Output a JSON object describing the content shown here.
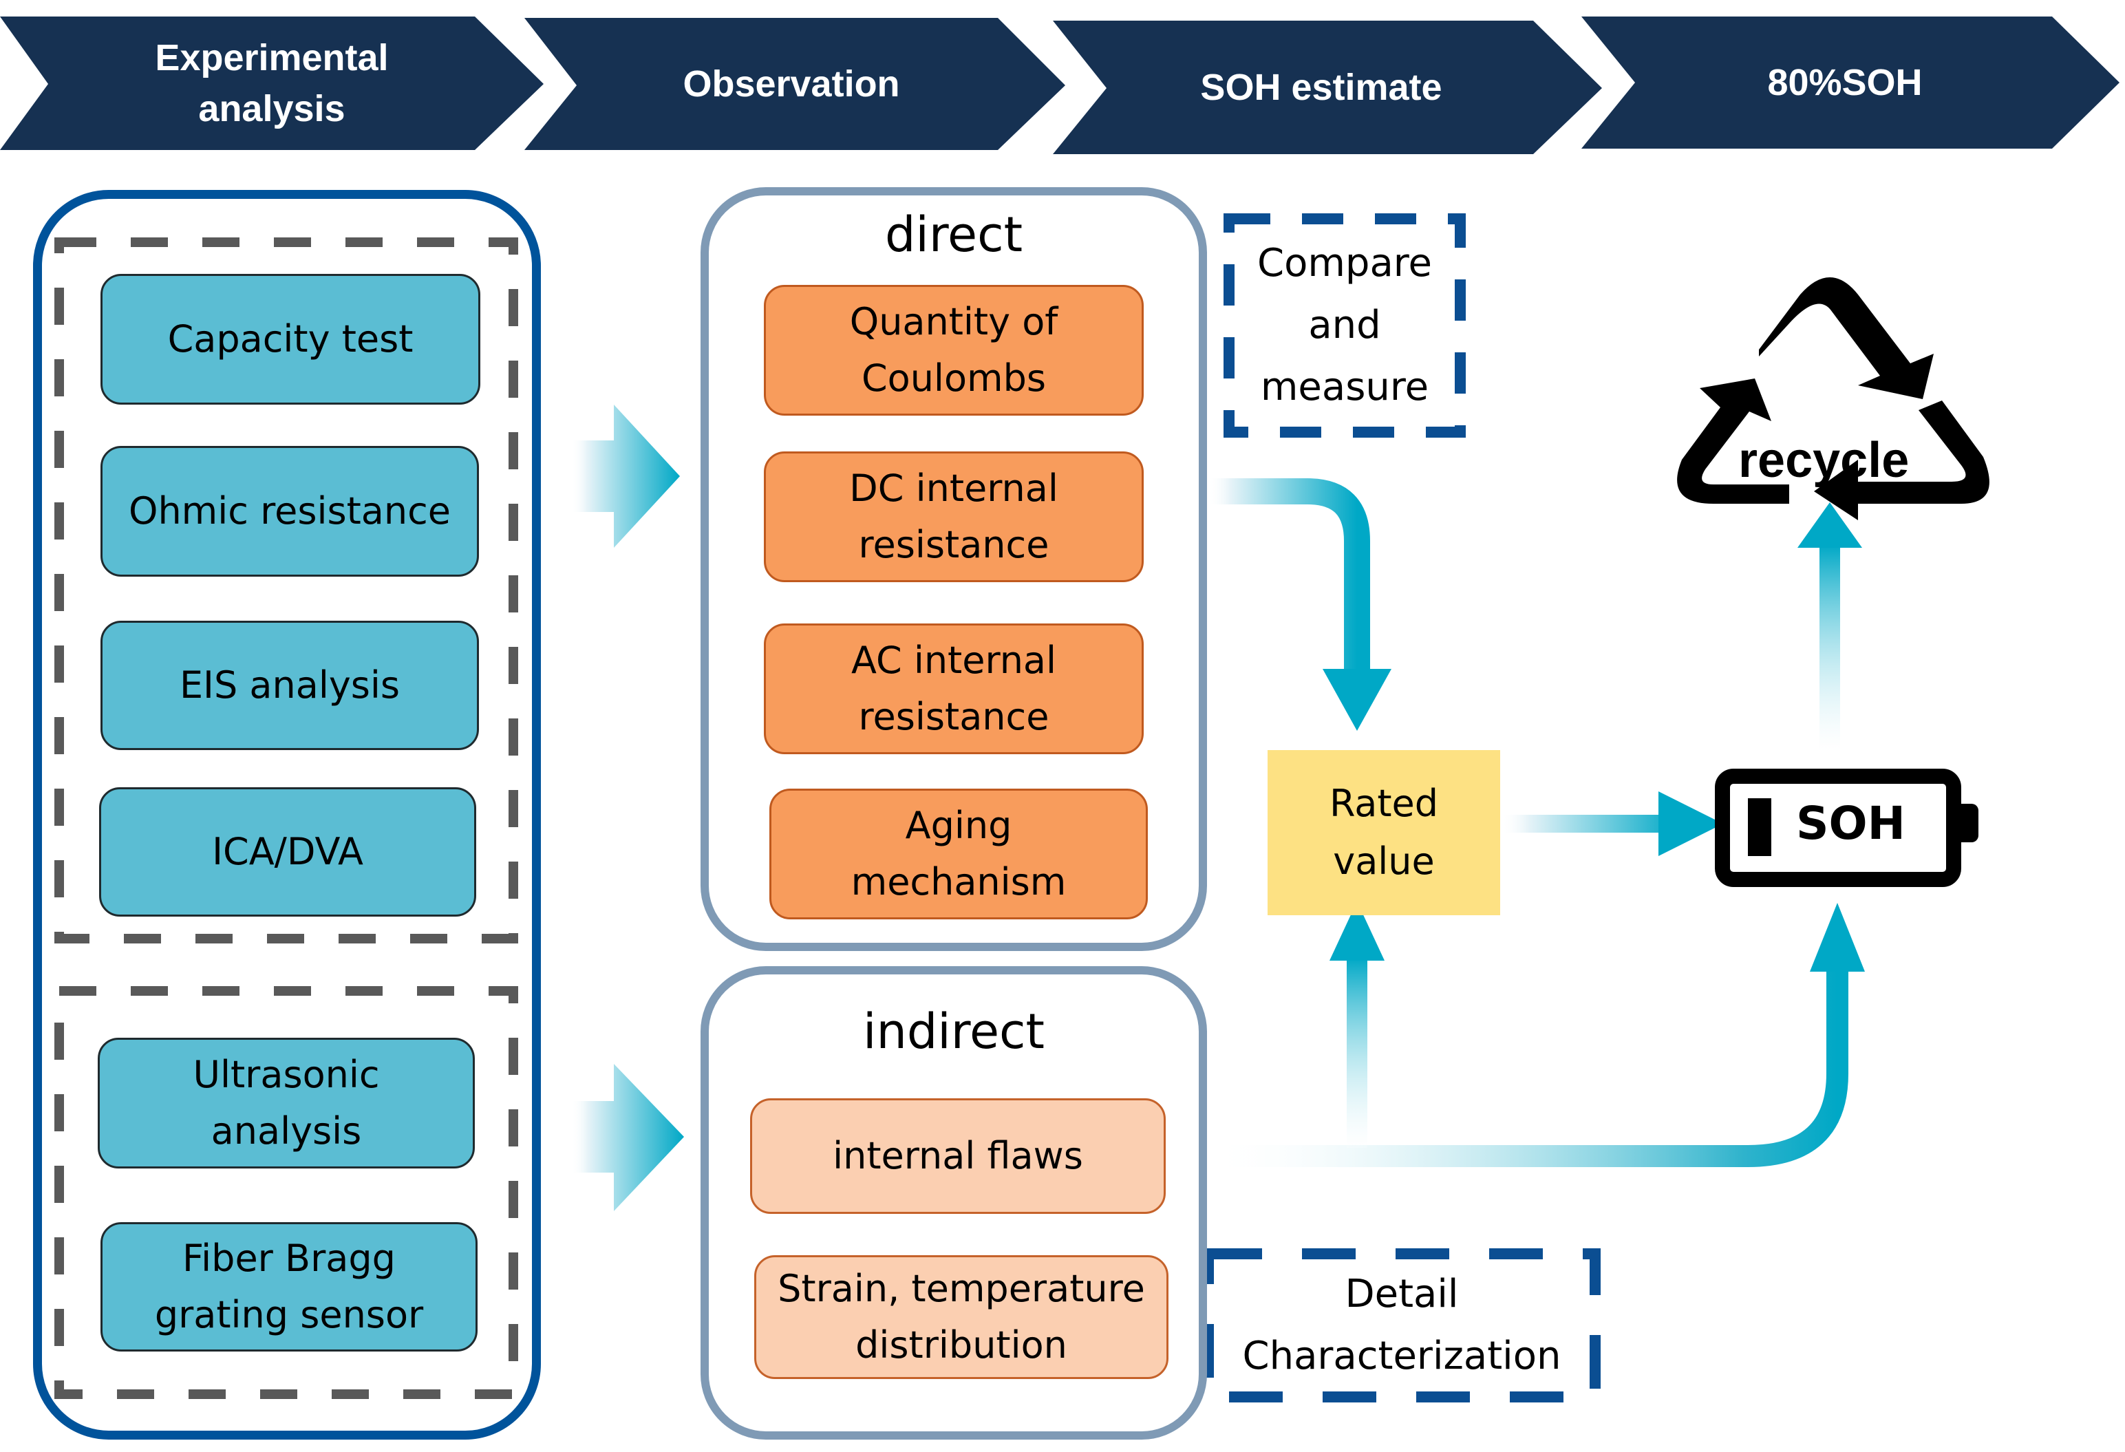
{
  "pipeline": {
    "stages": [
      {
        "label": "Experimental\nanalysis"
      },
      {
        "label": "Observation"
      },
      {
        "label": "SOH estimate"
      },
      {
        "label": "80%SOH"
      }
    ]
  },
  "experimental": {
    "group_a": [
      {
        "label": "Capacity test"
      },
      {
        "label": "Ohmic resistance"
      },
      {
        "label": "EIS analysis"
      },
      {
        "label": "ICA/DVA"
      }
    ],
    "group_b": [
      {
        "label": "Ultrasonic\nanalysis"
      },
      {
        "label": "Fiber Bragg\ngrating sensor"
      }
    ]
  },
  "observation": {
    "direct": {
      "title": "direct",
      "items": [
        {
          "label": "Quantity of\nCoulombs"
        },
        {
          "label": "DC internal\nresistance"
        },
        {
          "label": "AC internal\nresistance"
        },
        {
          "label": "Aging\nmechanism"
        }
      ]
    },
    "indirect": {
      "title": "indirect",
      "items": [
        {
          "label": "internal flaws"
        },
        {
          "label": "Strain, temperature\ndistribution"
        }
      ]
    }
  },
  "notes": {
    "compare": "Compare\nand\nmeasure",
    "detail": "Detail\nCharacterization"
  },
  "estimate": {
    "rated_value": "Rated\nvalue",
    "battery_label": "SOH"
  },
  "recycle": {
    "label": "recycle"
  },
  "colors": {
    "header": "#163152",
    "outer_border": "#00539b",
    "group_border": "#7f9ab5",
    "teal_item": "#5bbdd3",
    "orange_item": "#f89c5c",
    "peach_item": "#fbcfb1",
    "rated": "#fde183",
    "arrow": "#00a8c6",
    "note_border": "#0b4e92"
  }
}
